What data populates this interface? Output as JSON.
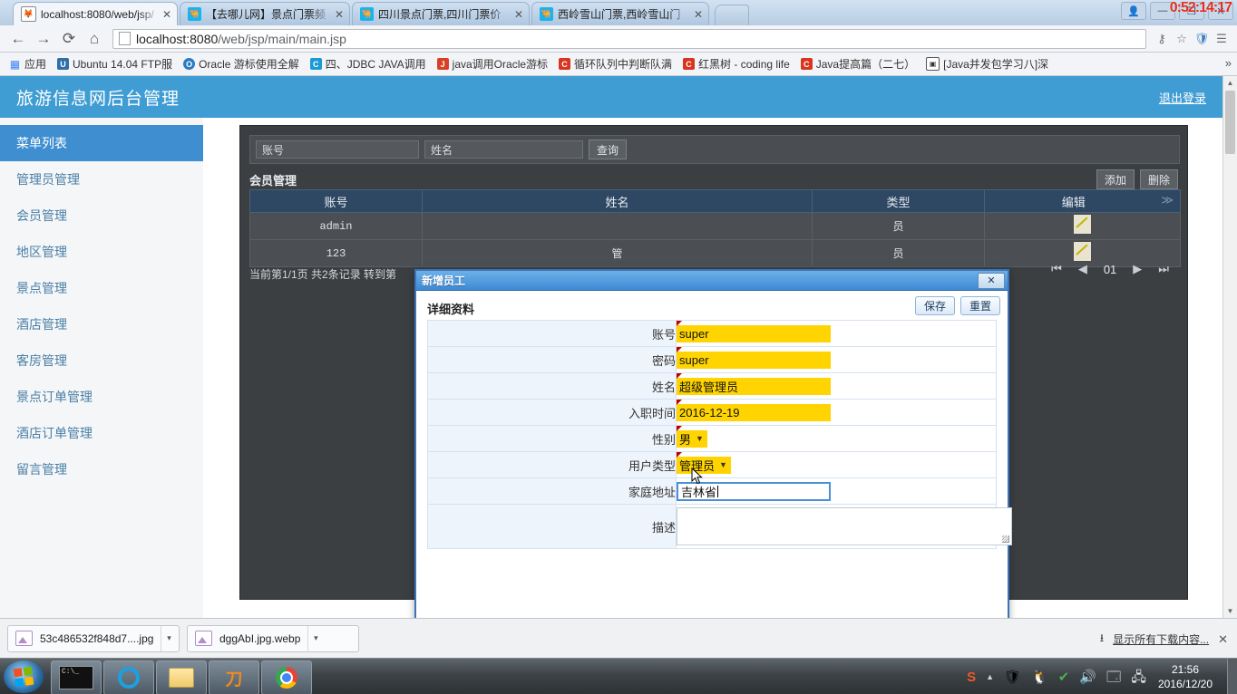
{
  "browser": {
    "tabs": [
      {
        "title": "localhost:8080/web/jsp/",
        "favicon": "firefox-icon",
        "active": true
      },
      {
        "title": "【去哪儿网】景点门票频",
        "favicon": "qunar-icon",
        "active": false
      },
      {
        "title": "四川景点门票,四川门票价",
        "favicon": "qunar-icon",
        "active": false
      },
      {
        "title": "西岭雪山门票,西岭雪山门",
        "favicon": "qunar-icon",
        "active": false
      }
    ],
    "new_tab_label": "",
    "nav": {
      "back_icon": "back-arrow-icon",
      "forward_icon": "forward-arrow-icon",
      "reload_icon": "reload-icon",
      "home_icon": "home-icon",
      "url_host": "localhost:8080",
      "url_path": "/web/jsp/main/main.jsp",
      "key_icon": "key-icon",
      "star_icon": "star-icon",
      "shield_icon": "shield-icon",
      "menu_icon": "hamburger-menu-icon"
    },
    "window_controls": {
      "user_icon": "user-icon",
      "overlay_time": "0:52:14:17"
    },
    "bookmarks": [
      {
        "label": "应用",
        "icon": "apps-grid-icon"
      },
      {
        "label": "Ubuntu 14.04 FTP服",
        "icon": "ubuntu-icon"
      },
      {
        "label": "Oracle 游标使用全解",
        "icon": "oracle-icon"
      },
      {
        "label": "四、JDBC JAVA调用",
        "icon": "csdn-icon"
      },
      {
        "label": "java调用Oracle游标",
        "icon": "java-icon"
      },
      {
        "label": "循环队列中判断队满",
        "icon": "csdn-icon"
      },
      {
        "label": "红黑树 - coding life",
        "icon": "csdn-icon"
      },
      {
        "label": "Java提高篇（二七）",
        "icon": "csdn-icon"
      },
      {
        "label": "[Java并发包学习八]深",
        "icon": "monitor-icon"
      }
    ],
    "bookmarks_overflow": "»"
  },
  "app": {
    "brand": "旅游信息网后台管理",
    "logout_label": "退出登录",
    "sidebar": {
      "header": "菜单列表",
      "items": [
        {
          "label": "管理员管理"
        },
        {
          "label": "会员管理"
        },
        {
          "label": "地区管理"
        },
        {
          "label": "景点管理"
        },
        {
          "label": "酒店管理"
        },
        {
          "label": "客房管理"
        },
        {
          "label": "景点订单管理"
        },
        {
          "label": "酒店订单管理"
        },
        {
          "label": "留言管理"
        }
      ]
    },
    "search": {
      "account_placeholder": "账号",
      "name_placeholder": "姓名",
      "query_button": "查询"
    },
    "grid": {
      "title": "会员管理",
      "add_button": "添加",
      "delete_button": "删除",
      "columns": [
        "账号",
        "姓名",
        "类型",
        "编辑"
      ],
      "rows": [
        {
          "account": "admin",
          "name": "",
          "type": "员",
          "edit_icon": "edit-pencil-icon"
        },
        {
          "account": "123",
          "name": "管",
          "type": "员",
          "edit_icon": "edit-pencil-icon"
        }
      ],
      "column_resize_icon": "columns-toggle-icon"
    },
    "pager": {
      "summary": "当前第1/1页 共2条记录 转到第",
      "first_icon": "first-page-icon",
      "prev_icon": "prev-page-icon",
      "page_number": "01",
      "next_icon": "next-page-icon",
      "last_icon": "last-page-icon"
    }
  },
  "modal": {
    "title": "新增员工",
    "close_icon": "close-icon",
    "section_title": "详细资料",
    "save_button": "保存",
    "reset_button": "重置",
    "fields": [
      {
        "label": "账号",
        "value": "super",
        "kind": "text",
        "required": true
      },
      {
        "label": "密码",
        "value": "super",
        "kind": "text",
        "required": true
      },
      {
        "label": "姓名",
        "value": "超级管理员",
        "kind": "text",
        "required": true
      },
      {
        "label": "入职时间",
        "value": "2016-12-19",
        "kind": "text",
        "required": true
      },
      {
        "label": "性别",
        "value": "男",
        "kind": "select",
        "required": true
      },
      {
        "label": "用户类型",
        "value": "管理员",
        "kind": "select",
        "required": true
      },
      {
        "label": "家庭地址",
        "value": "吉林省",
        "kind": "focused",
        "required": false
      },
      {
        "label": "描述",
        "value": "",
        "kind": "textarea",
        "required": false
      }
    ]
  },
  "downloads": {
    "items": [
      {
        "name": "53c486532f848d7....jpg",
        "icon": "image-file-icon",
        "chevron": "▾"
      },
      {
        "name": "dggAbI.jpg.webp",
        "icon": "image-file-icon",
        "chevron": "▾"
      }
    ],
    "show_all_label": "显示所有下载内容...",
    "download_icon": "download-arrow-icon",
    "close_icon": "close-icon"
  },
  "taskbar": {
    "start_icon": "windows-start-icon",
    "buttons": [
      {
        "icon": "command-prompt-icon"
      },
      {
        "icon": "photoshop-icon"
      },
      {
        "icon": "file-explorer-icon"
      },
      {
        "icon": "jianying-icon"
      },
      {
        "icon": "chrome-icon"
      }
    ],
    "tray": [
      {
        "icon": "sogou-input-icon"
      },
      {
        "icon": "show-hidden-icons-icon"
      },
      {
        "icon": "antivirus-icon"
      },
      {
        "icon": "qq-icon"
      },
      {
        "icon": "360-checkmark-icon"
      },
      {
        "icon": "volume-icon"
      },
      {
        "icon": "action-center-icon"
      },
      {
        "icon": "network-icon"
      }
    ],
    "time": "21:56",
    "date": "2016/12/20"
  },
  "colors": {
    "app_header": "#3f9dd4",
    "sidebar_active": "#3f8fd0",
    "panel_dark": "#3b3f42",
    "field_yellow": "#ffd400",
    "modal_border": "#3a74b8"
  }
}
